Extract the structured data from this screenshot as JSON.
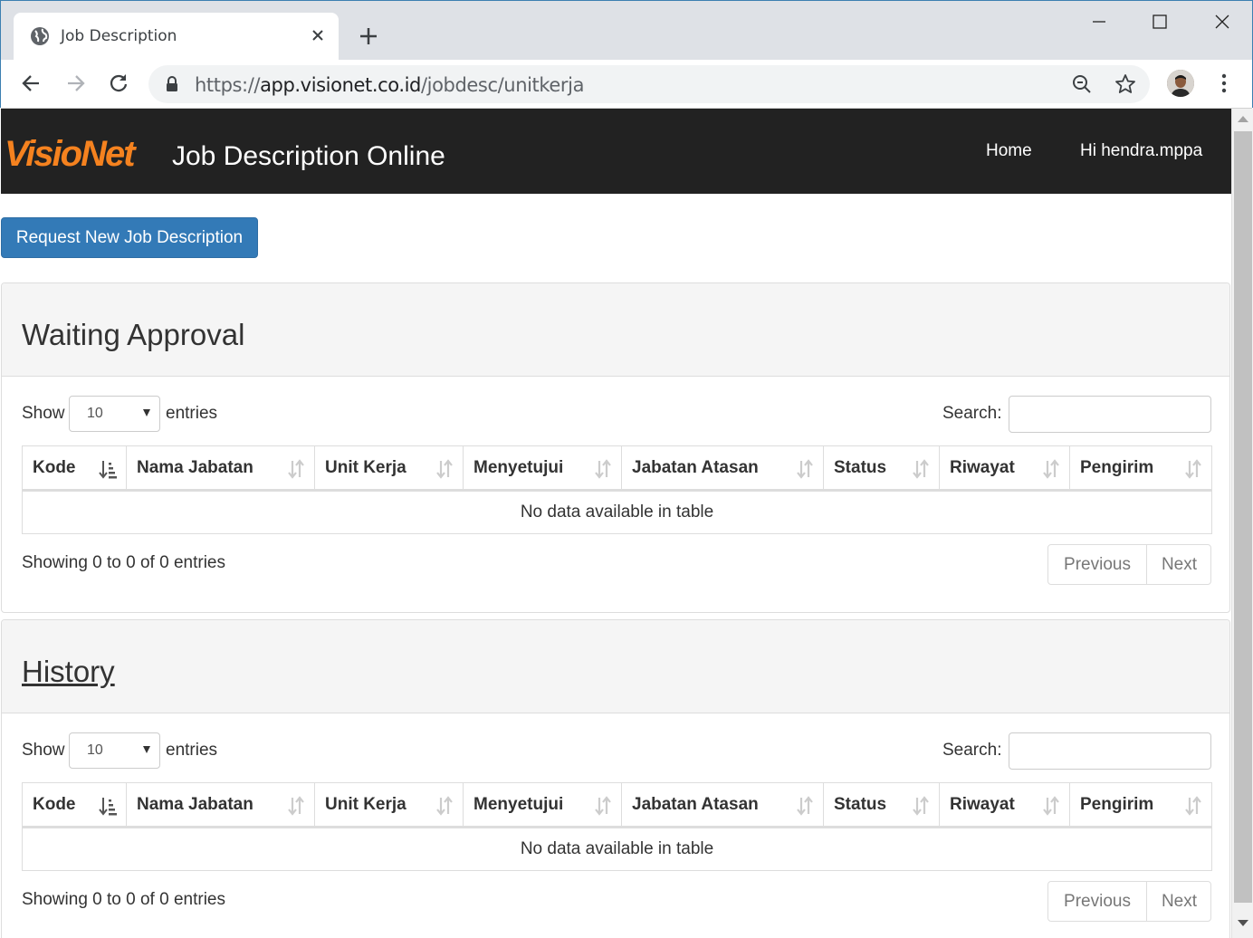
{
  "browser": {
    "tab_title": "Job Description",
    "url_scheme": "https://",
    "url_host": "app.visionet.co.id",
    "url_path": "/jobdesc/unitkerja"
  },
  "navbar": {
    "logo_text": "VisioNet",
    "brand_title": "Job Description Online",
    "links": [
      {
        "label": "Home"
      },
      {
        "label": "Hi hendra.mppa"
      }
    ]
  },
  "request_button_label": "Request New Job Description",
  "panels": [
    {
      "title": "Waiting Approval",
      "show_label": "Show",
      "page_length": "10",
      "entries_label": "entries",
      "search_label": "Search:",
      "columns": [
        "Kode",
        "Nama Jabatan",
        "Unit Kerja",
        "Menyetujui",
        "Jabatan Atasan",
        "Status",
        "Riwayat",
        "Pengirim"
      ],
      "empty_message": "No data available in table",
      "info": "Showing 0 to 0 of 0 entries",
      "prev_label": "Previous",
      "next_label": "Next"
    },
    {
      "title": "History",
      "show_label": "Show",
      "page_length": "10",
      "entries_label": "entries",
      "search_label": "Search:",
      "columns": [
        "Kode",
        "Nama Jabatan",
        "Unit Kerja",
        "Menyetujui",
        "Jabatan Atasan",
        "Status",
        "Riwayat",
        "Pengirim"
      ],
      "empty_message": "No data available in table",
      "info": "Showing 0 to 0 of 0 entries",
      "prev_label": "Previous",
      "next_label": "Next"
    }
  ],
  "colors": {
    "navbar_bg": "#222222",
    "logo": "#f5821f",
    "primary": "#337ab7"
  }
}
